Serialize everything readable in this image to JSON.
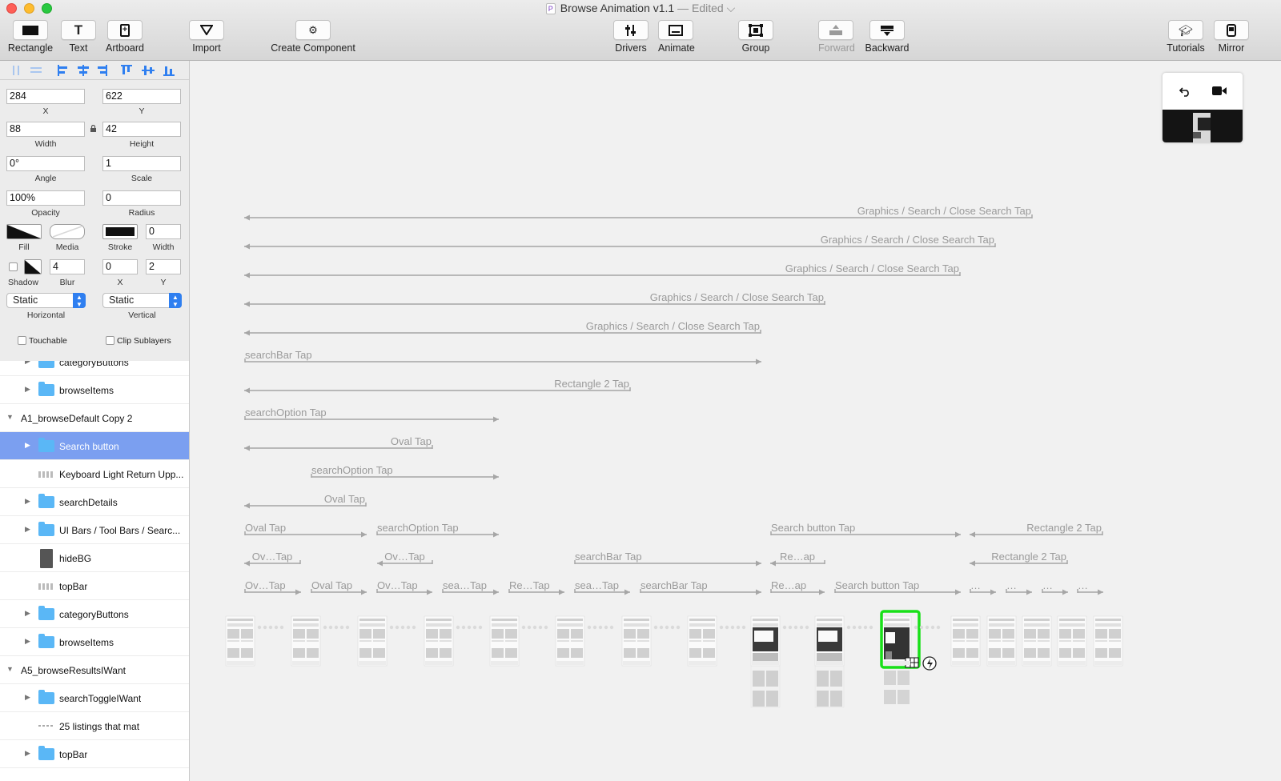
{
  "window": {
    "title": "Browse Animation v1.1",
    "status": "— Edited ⌵",
    "app_icon": "P"
  },
  "toolbar": {
    "rectangle": "Rectangle",
    "text": "Text",
    "artboard": "Artboard",
    "import": "Import",
    "create_component": "Create Component",
    "drivers": "Drivers",
    "animate": "Animate",
    "group": "Group",
    "forward": "Forward",
    "backward": "Backward",
    "tutorials": "Tutorials",
    "mirror": "Mirror"
  },
  "inspector": {
    "x": "284",
    "x_label": "X",
    "y": "622",
    "y_label": "Y",
    "width": "88",
    "width_label": "Width",
    "height": "42",
    "height_label": "Height",
    "angle": "0°",
    "angle_label": "Angle",
    "scale": "1",
    "scale_label": "Scale",
    "opacity": "100%",
    "opacity_label": "Opacity",
    "radius": "0",
    "radius_label": "Radius",
    "fill_label": "Fill",
    "media_label": "Media",
    "stroke_label": "Stroke",
    "stroke_width": "0",
    "stroke_width_label": "Width",
    "shadow_label": "Shadow",
    "blur": "4",
    "blur_label": "Blur",
    "shadow_x": "0",
    "shadow_x_label": "X",
    "shadow_y": "2",
    "shadow_y_label": "Y",
    "horizontal": "Static",
    "horizontal_label": "Horizontal",
    "vertical": "Static",
    "vertical_label": "Vertical",
    "touchable": "Touchable",
    "clip_sublayers": "Clip Sublayers"
  },
  "layers": [
    {
      "name": "categoryButtons",
      "type": "folder",
      "expanded": false
    },
    {
      "name": "browseItems",
      "type": "folder",
      "expanded": false
    },
    {
      "name": "A1_browseDefault Copy 2",
      "type": "group",
      "expanded": true
    },
    {
      "name": "Search button",
      "type": "folder",
      "expanded": false,
      "selected": true
    },
    {
      "name": "Keyboard Light Return Upp...",
      "type": "image"
    },
    {
      "name": "searchDetails",
      "type": "folder",
      "expanded": false
    },
    {
      "name": "UI Bars / Tool Bars / Searc...",
      "type": "folder",
      "expanded": false
    },
    {
      "name": "hideBG",
      "type": "rect"
    },
    {
      "name": "topBar",
      "type": "image"
    },
    {
      "name": "categoryButtons",
      "type": "folder",
      "expanded": false
    },
    {
      "name": "browseItems",
      "type": "folder",
      "expanded": false
    },
    {
      "name": "A5_browseResultsIWant",
      "type": "group",
      "expanded": true
    },
    {
      "name": "searchToggleIWant",
      "type": "folder",
      "expanded": false
    },
    {
      "name": "25 listings that mat",
      "type": "text"
    },
    {
      "name": "topBar",
      "type": "folder",
      "expanded": false
    }
  ],
  "transitions": [
    {
      "label": "Graphics / Search / Close Search Tap",
      "dir": "left"
    },
    {
      "label": "Graphics / Search / Close Search Tap",
      "dir": "left"
    },
    {
      "label": "Graphics / Search / Close Search Tap",
      "dir": "left"
    },
    {
      "label": "Graphics / Search / Close Search Tap",
      "dir": "left"
    },
    {
      "label": "Graphics / Search / Close Search Tap",
      "dir": "left"
    },
    {
      "label": "searchBar Tap",
      "dir": "right"
    },
    {
      "label": "Rectangle 2 Tap",
      "dir": "left"
    },
    {
      "label": "searchOption Tap",
      "dir": "right"
    },
    {
      "label": "Oval Tap",
      "dir": "left"
    },
    {
      "label": "searchOption Tap",
      "dir": "right"
    },
    {
      "label": "Oval Tap",
      "dir": "left"
    },
    {
      "label": "Oval Tap",
      "dir": "right"
    },
    {
      "label": "searchOption Tap",
      "dir": "right"
    },
    {
      "label": "Search button Tap",
      "dir": "right"
    },
    {
      "label": "Rectangle 2 Tap",
      "dir": "left"
    },
    {
      "label": "Ov…Tap",
      "dir": "left"
    },
    {
      "label": "Ov…Tap",
      "dir": "left"
    },
    {
      "label": "searchBar Tap",
      "dir": "right"
    },
    {
      "label": "Re…ap",
      "dir": "left"
    },
    {
      "label": "Rectangle 2 Tap",
      "dir": "left"
    },
    {
      "label": "Ov…Tap",
      "dir": "right"
    },
    {
      "label": "Oval Tap",
      "dir": "right"
    },
    {
      "label": "Ov…Tap",
      "dir": "right"
    },
    {
      "label": "sea…Tap",
      "dir": "right"
    },
    {
      "label": "Re…Tap",
      "dir": "right"
    },
    {
      "label": "sea…Tap",
      "dir": "right"
    },
    {
      "label": "searchBar Tap",
      "dir": "right"
    },
    {
      "label": "Re…ap",
      "dir": "right"
    },
    {
      "label": "Search button Tap",
      "dir": "right"
    },
    {
      "label": "…",
      "dir": "right"
    },
    {
      "label": "…",
      "dir": "right"
    },
    {
      "label": "…",
      "dir": "right"
    },
    {
      "label": "…",
      "dir": "right"
    }
  ],
  "artboards": [
    {
      "style": "light"
    },
    {
      "style": "light"
    },
    {
      "style": "light"
    },
    {
      "style": "light"
    },
    {
      "style": "light"
    },
    {
      "style": "light"
    },
    {
      "style": "light"
    },
    {
      "style": "light"
    },
    {
      "style": "dark-tall"
    },
    {
      "style": "dark-tall"
    },
    {
      "style": "selected"
    },
    {
      "style": "light"
    },
    {
      "style": "light"
    },
    {
      "style": "light"
    },
    {
      "style": "light"
    },
    {
      "style": "light"
    }
  ],
  "colors": {
    "selection_green": "#18e018",
    "layer_selected": "#7b9ff0",
    "arrow_gray": "#a6a6a6",
    "folder_blue": "#5ab7f6"
  }
}
